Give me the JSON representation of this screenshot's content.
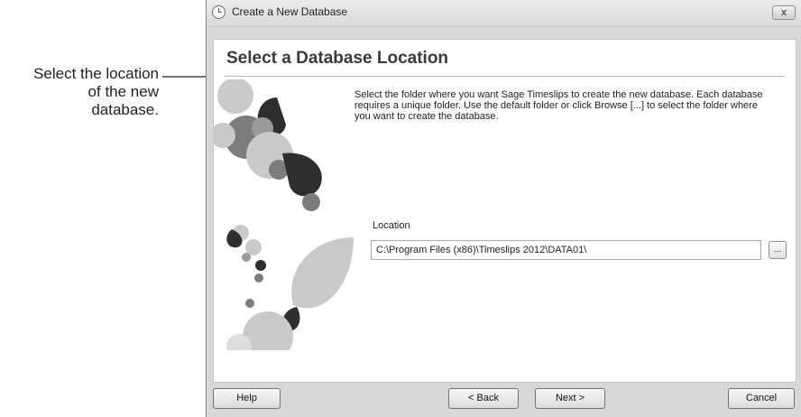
{
  "annotation": {
    "lines": [
      "Select the location",
      "of the new",
      "database."
    ]
  },
  "window": {
    "title": "Create a New Database",
    "close_symbol": "x"
  },
  "page": {
    "title": "Select a Database Location",
    "description": "Select the folder where you want Sage Timeslips to create the new database. Each database requires a unique folder. Use the default folder or click Browse [...] to select the folder where you want to create the database."
  },
  "location": {
    "label": "Location",
    "value": "C:\\Program Files (x86)\\Timeslips 2012\\DATA01\\",
    "browse_label": "..."
  },
  "buttons": {
    "help": "Help",
    "back": "< Back",
    "next": "Next >",
    "cancel": "Cancel"
  },
  "icons": {
    "app": "clock-icon",
    "close": "close-icon",
    "decoration": "droplet-pattern"
  },
  "colors": {
    "window_frame": "#d7d7d7",
    "panel": "#ffffff",
    "shape_dark": "#2e2e2e",
    "shape_mid": "#7c7c7c",
    "shape_light": "#c9c9c9"
  }
}
